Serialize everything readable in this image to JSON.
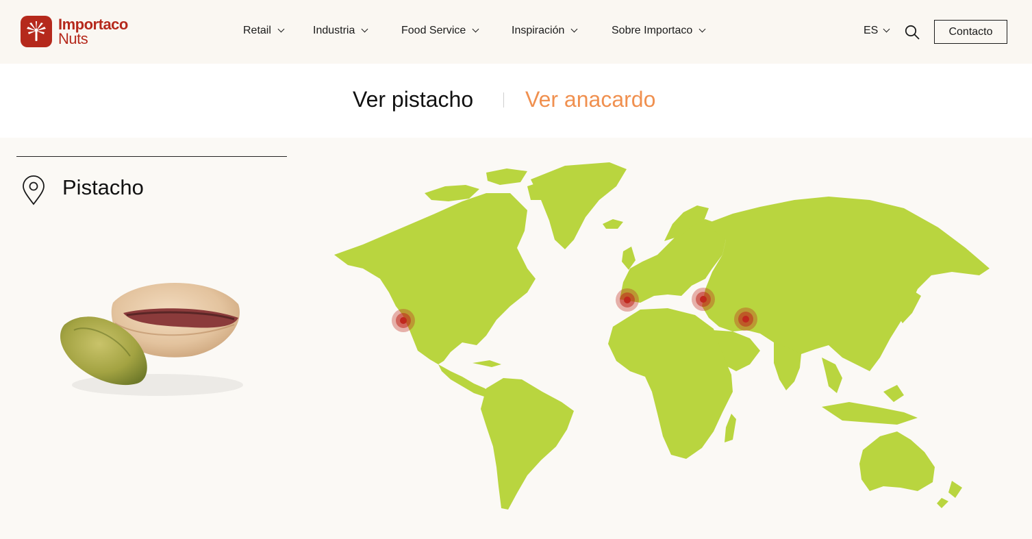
{
  "brand": {
    "line1": "Importaco",
    "line2": "Nuts",
    "color": "#b5291c"
  },
  "nav": {
    "items": [
      {
        "label": "Retail"
      },
      {
        "label": "Industria"
      },
      {
        "label": "Food Service"
      },
      {
        "label": "Inspiración"
      },
      {
        "label": "Sobre Importaco"
      }
    ],
    "language": "ES",
    "contact_label": "Contacto"
  },
  "tabs": {
    "pistacho": "Ver pistacho",
    "anacardo": "Ver anacardo",
    "accent": "#f0904f"
  },
  "panel": {
    "title": "Pistacho"
  },
  "map": {
    "land_color": "#b9d53f",
    "marker_color": "#c0281e",
    "markers": [
      "california-marker",
      "spain-marker",
      "turkey-marker",
      "iran-marker"
    ]
  },
  "icons": [
    "palm-logo-icon",
    "chevron-down-icon",
    "search-icon",
    "location-pin-icon"
  ]
}
